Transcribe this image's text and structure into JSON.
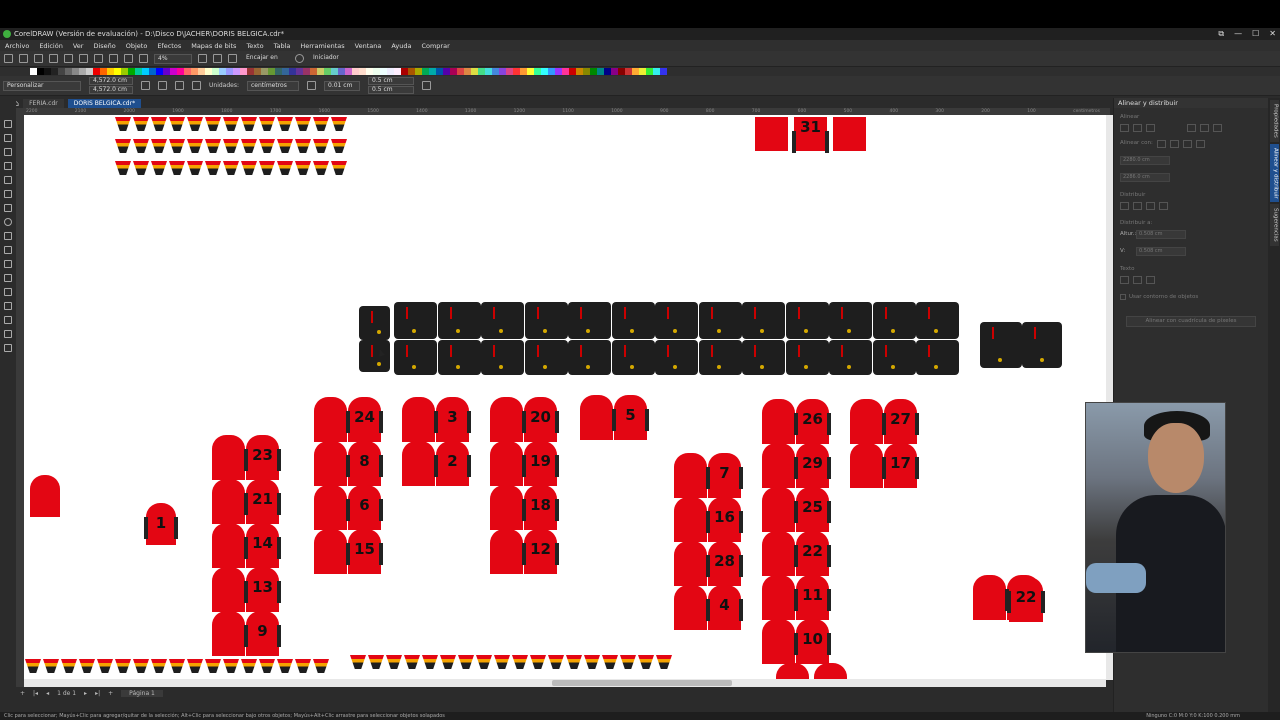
{
  "app": {
    "title": "CorelDRAW (Versión de evaluación) - D:\\Disco D\\JACHER\\DORIS BELGICA.cdr*",
    "window_buttons": [
      "⧉",
      "—",
      "☐",
      "✕"
    ]
  },
  "menu": [
    "Archivo",
    "Edición",
    "Ver",
    "Diseño",
    "Objeto",
    "Efectos",
    "Mapas de bits",
    "Texto",
    "Tabla",
    "Herramientas",
    "Ventana",
    "Ayuda",
    "Comprar"
  ],
  "toolbar1": {
    "zoom": "4%",
    "snap": "Encajar en",
    "launcher": "Iniciador"
  },
  "toolbar2": {
    "preset": "Personalizar",
    "width": "4,572.0 cm",
    "height": "4,572.0 cm",
    "units_label": "Unidades:",
    "units": "centímetros",
    "nudge": "0.01 cm",
    "dup_x": "0.5 cm",
    "dup_y": "0.5 cm"
  },
  "tabs": [
    {
      "label": "FERIA.cdr",
      "active": false
    },
    {
      "label": "DORIS BELGICA.cdr*",
      "active": true
    }
  ],
  "ruler_ticks": [
    "2200",
    "2100",
    "2000",
    "1900",
    "1800",
    "1700",
    "1600",
    "1500",
    "1400",
    "1300",
    "1200",
    "1100",
    "1000",
    "900",
    "800",
    "700",
    "600",
    "500",
    "400",
    "300",
    "200",
    "100"
  ],
  "ruler_unit": "centímetros",
  "jersey_numbers": [
    "31",
    "24",
    "3",
    "20",
    "5",
    "26",
    "27",
    "23",
    "8",
    "2",
    "19",
    "29",
    "17",
    "21",
    "6",
    "18",
    "7",
    "25",
    "1",
    "14",
    "15",
    "12",
    "16",
    "22",
    "13",
    "28",
    "4",
    "11",
    "9",
    "10",
    "20",
    "22"
  ],
  "page_nav": {
    "counter": "1 de 1",
    "page_tab": "Página 1"
  },
  "statusbar": {
    "hint": "Clic para seleccionar; Mayús+Clic para agregar/quitar de la selección; Alt+Clic para seleccionar bajo otros objetos; Mayús+Alt+Clic arrastre para seleccionar objetos solapados",
    "right": "Ninguno   C:0 M:0 Y:0 K:100  0.200 mm"
  },
  "panel": {
    "title": "Alinear y distribuir",
    "align_section": "Alinear",
    "align_to": "Alinear con:",
    "x_field": "2280.0 cm",
    "y_field": "2286.0 cm",
    "distribute_section": "Distribuir",
    "distribute_to": "Distribuir a:",
    "h_label": "Altur.:",
    "h_field": "0.508 cm",
    "v_label": "V:",
    "v_field": "0.508 cm",
    "text_section": "Texto",
    "outline_check": "Usar contorno de objetos",
    "grid_button": "Alinear con cuadrícula de píxeles"
  },
  "side_tabs": [
    {
      "label": "Propiedades",
      "active": false
    },
    {
      "label": "Alinear y distribuir",
      "active": true
    },
    {
      "label": "Sugerencias",
      "active": false
    }
  ],
  "colors": {
    "jersey_red": "#e30613",
    "short_black": "#1e1e1e",
    "accent_blue": "#1f4f8f"
  }
}
